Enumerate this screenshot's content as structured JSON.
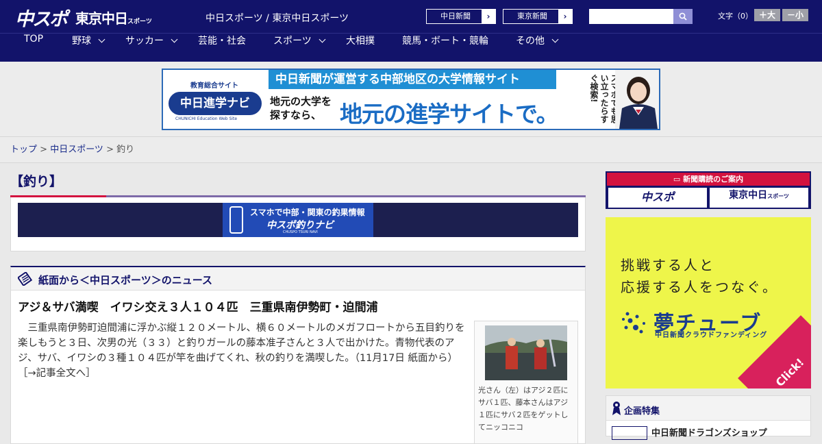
{
  "header": {
    "logo_chuspo": "中スポ",
    "logo_tokyo": "東京中日",
    "logo_tokyo_small": "スポーツ",
    "site_title": "中日スポーツ / 東京中日スポーツ",
    "links": [
      {
        "label": "中日新聞",
        "arrow": "›"
      },
      {
        "label": "東京新聞",
        "arrow": "›"
      }
    ],
    "search_placeholder": "",
    "font_label": "文字（0）",
    "font_plus": "＋大",
    "font_minus": "－小"
  },
  "nav": {
    "items": [
      {
        "label": "TOP",
        "dropdown": false
      },
      {
        "label": "野球",
        "dropdown": true
      },
      {
        "label": "サッカー",
        "dropdown": true
      },
      {
        "label": "芸能・社会",
        "dropdown": false
      },
      {
        "label": "スポーツ",
        "dropdown": true
      },
      {
        "label": "大相撲",
        "dropdown": false
      },
      {
        "label": "競馬・ボート・競輪",
        "dropdown": false
      },
      {
        "label": "その他",
        "dropdown": true
      }
    ]
  },
  "banner": {
    "tag": "教育総合サイト",
    "navi": "中日進学ナビ",
    "eng": "CHUNICHI Education Web Site",
    "headline": "中日新聞が運営する中部地区の大学情報サイト",
    "sub1": "地元の大学を",
    "sub2": "探すなら、",
    "big": "地元の進学サイトで。",
    "vertical": "スマホでも思い立ったらすぐ検索!"
  },
  "breadcrumb": {
    "home": "トップ",
    "sep": " > ",
    "section": "中日スポーツ",
    "current": "釣り"
  },
  "main": {
    "category_title": "【釣り】",
    "tsuri_banner": {
      "line1": "スマホで中部・関東の釣果情報",
      "line2": "中スポ釣りナビ",
      "line3": "CHUSPO TSURI NAVI"
    },
    "news_heading": "紙面から＜中日スポーツ＞のニュース",
    "article": {
      "title": "アジ＆サバ満喫　イワシ交え３人１０４匹　三重県南伊勢町・迫間浦",
      "body": "三重県南伊勢町迫間浦に浮かぶ縦１２０メートル、横６０メートルのメガフロートから五目釣りを楽しもうと３日、次男の光（３３）と釣りガールの藤本准子さんと３人で出かけた。青物代表のアジ、サバ、イワシの３種１０４匹が竿を曲げてくれ、秋の釣りを満喫した。（11月17日 紙面から）",
      "more": "［→記事全文へ］",
      "photo_caption": "光さん（左）はアジ２匹にサバ１匹、藤本さんはアジ１匹にサバ２匹をゲットしてニッコニコ"
    }
  },
  "sidebar": {
    "subscribe_head": "新聞購読のご案内",
    "subscribe_chuspo": "中スポ",
    "subscribe_tokyo": "東京中日",
    "subscribe_tokyo_small": "スポーツ",
    "ad": {
      "line1": "挑戦する人と",
      "line2": "応援する人をつなぐ。",
      "brand": "夢チューブ",
      "sub": "中日新聞クラウドファンディング",
      "click": "Click!"
    },
    "feature_heading": "企画特集",
    "feature_item": "中日新聞ドラゴンズショップ"
  },
  "colors": {
    "navy": "#12136a",
    "accent_red": "#d3123f",
    "link_blue": "#1a2c8a"
  }
}
